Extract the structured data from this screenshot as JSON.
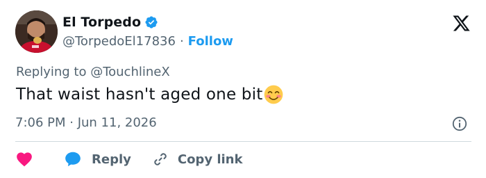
{
  "author": {
    "display_name": "El Torpedo",
    "handle": "@TorpedoEl17836",
    "separator": "·",
    "follow_label": "Follow",
    "avatar_icon": "profile-photo",
    "verified_icon": "verified-badge-icon",
    "verified_color": "#1d9bf0"
  },
  "brand": {
    "logo_icon": "x-logo-icon"
  },
  "tweet": {
    "reply_context": "Replying to @TouchlineX",
    "text": "That waist hasn't aged one bit",
    "emoji": "smiling-face-with-blush-emoji",
    "timestamp": "7:06 PM · Jun 11, 2026"
  },
  "actions": {
    "like_icon": "heart-icon",
    "like_color": "#f91880",
    "reply_icon": "speech-bubble-icon",
    "reply_color": "#1d9bf0",
    "reply_label": "Reply",
    "copy_icon": "link-icon",
    "copy_label": "Copy link"
  },
  "colors": {
    "text_primary": "#0f1419",
    "text_secondary": "#536471",
    "accent": "#1d9bf0",
    "divider": "#cfd9de"
  }
}
